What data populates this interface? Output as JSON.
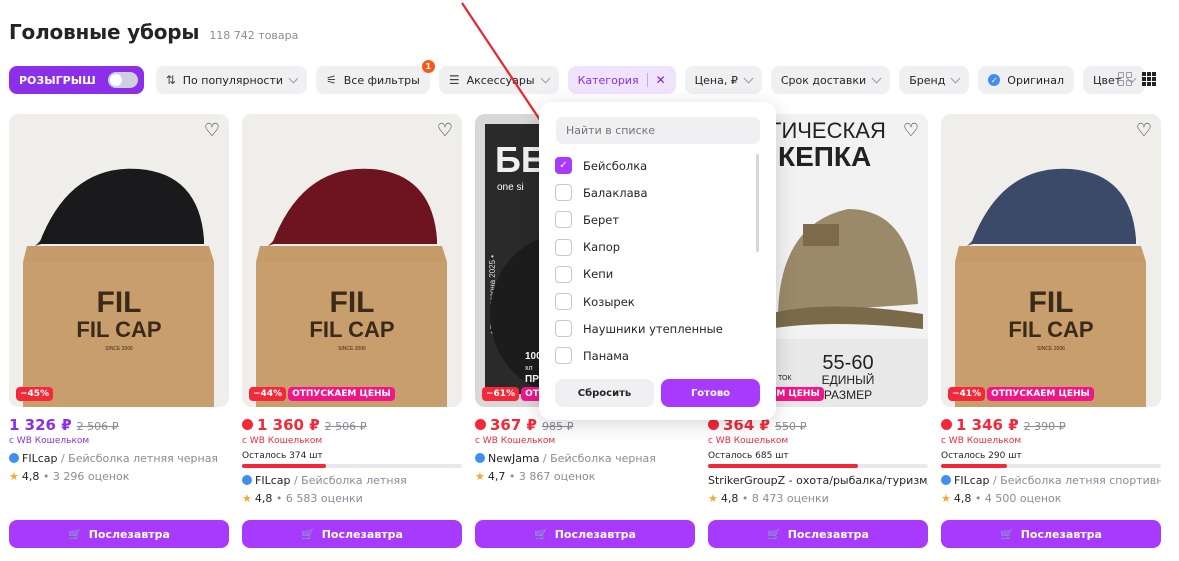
{
  "header": {
    "title": "Головные уборы",
    "count": "118 742 товара"
  },
  "filters": {
    "promo_label": "РОЗЫГРЫШ",
    "sort_label": "По популярности",
    "all_filters_label": "Все фильтры",
    "all_filters_badge": "1",
    "accessories_label": "Аксессуары",
    "category_label": "Категория",
    "category_clear": "✕",
    "price_label": "Цена, ₽",
    "delivery_label": "Срок доставки",
    "brand_label": "Бренд",
    "original_label": "Оригинал",
    "color_label": "Цвет"
  },
  "dropdown": {
    "search_placeholder": "Найти в списке",
    "items": [
      {
        "label": "Бейсболка",
        "checked": true
      },
      {
        "label": "Балаклава",
        "checked": false
      },
      {
        "label": "Берет",
        "checked": false
      },
      {
        "label": "Капор",
        "checked": false
      },
      {
        "label": "Кепи",
        "checked": false
      },
      {
        "label": "Козырек",
        "checked": false
      },
      {
        "label": "Наушники утепленные",
        "checked": false
      },
      {
        "label": "Панама",
        "checked": false
      }
    ],
    "reset_label": "Сбросить",
    "done_label": "Готово"
  },
  "cards": [
    {
      "discount": "−45%",
      "promo": "",
      "price": "1 326 ₽",
      "old_price": "2 506 ₽",
      "wallet": "с WB Кошельком",
      "stock": "",
      "stock_fill": 0,
      "brand": "FILcap",
      "desc": " / Бейсболка летняя черная",
      "rating": "4,8",
      "reviews": "3 296 оценок",
      "buy": "Послезавтра",
      "cap_color": "#1a1a1c",
      "box_text": "FIL CAP"
    },
    {
      "discount": "−44%",
      "promo": "ОТПУСКАЕМ ЦЕНЫ",
      "price": "1 360 ₽",
      "old_price": "2 506 ₽",
      "wallet": "с WB Кошельком",
      "stock": "Осталось 374 шт",
      "stock_fill": 0.38,
      "brand": "FILcap",
      "desc": " / Бейсболка летняя",
      "rating": "4,8",
      "reviews": "6 583 оценки",
      "buy": "Послезавтра",
      "cap_color": "#6e1420",
      "box_text": "FIL CAP"
    },
    {
      "discount": "−61%",
      "promo": "ОТПУСКАЕМ ЦЕНЫ",
      "price": "367 ₽",
      "old_price": "985 ₽",
      "wallet": "с WB Кошельком",
      "stock": "",
      "stock_fill": 0,
      "brand": "NewJama",
      "desc": " / Бейсболка черная",
      "rating": "4,7",
      "reviews": "3 867 оценок",
      "buy": "Послезавтра",
      "cap_color": "#1a1a1c",
      "box_text": ""
    },
    {
      "discount": "",
      "promo": "ОТПУСКАЕМ ЦЕНЫ",
      "price": "364 ₽",
      "old_price": "550 ₽",
      "wallet": "с WB Кошельком",
      "stock": "Осталось 685 шт",
      "stock_fill": 0.68,
      "brand": "StrikerGroupZ - охота/рыбалка/туризм/...",
      "desc": "",
      "rating": "4,8",
      "reviews": "8 473 оценки",
      "buy": "Послезавтра",
      "cap_color": "#8a7a5a",
      "box_text": ""
    },
    {
      "discount": "−41%",
      "promo": "ОТПУСКАЕМ ЦЕНЫ",
      "price": "1 346 ₽",
      "old_price": "2 390 ₽",
      "wallet": "с WB Кошельком",
      "stock": "Осталось 290 шт",
      "stock_fill": 0.3,
      "brand": "FILcap",
      "desc": " / Бейсболка летняя спортивная",
      "rating": "4,8",
      "reviews": "4 500 оценок",
      "buy": "Послезавтра",
      "cap_color": "#3c4a6a",
      "box_text": "FIL CAP"
    }
  ],
  "images": {
    "card3_brand": "БЕЙ",
    "card3_size": "one si",
    "card3_season": "• тренд сезона 2025 •",
    "card3_spec1": "100",
    "card3_spec2": "хл",
    "card3_spec3": "ПРЕ",
    "card4_title1": "ТИЧЕСКАЯ",
    "card4_title2": "КЕПКА",
    "card4_size": "55-60",
    "card4_uni": "ЕДИНЫЙ",
    "card4_razmer": "РАЗМЕР",
    "card4_stock": "ТОК",
    "box_since": "SINCE 2006"
  }
}
